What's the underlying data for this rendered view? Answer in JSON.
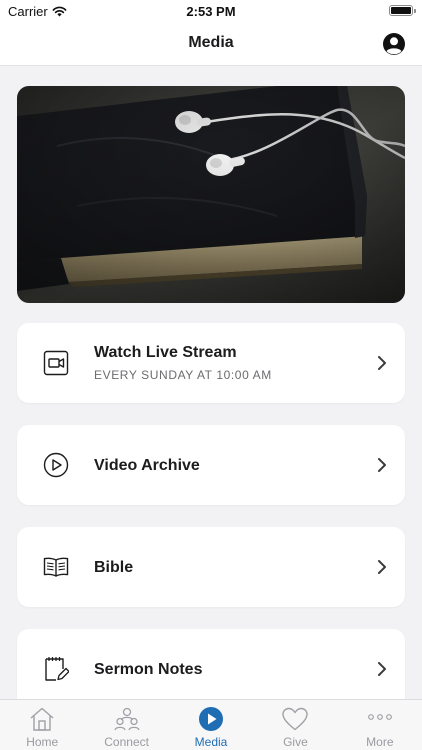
{
  "status_bar": {
    "carrier": "Carrier",
    "time": "2:53 PM"
  },
  "nav": {
    "title": "Media",
    "profile_icon": "person-circle-icon"
  },
  "hero": {
    "image": "earphones-on-bible-photo"
  },
  "menu": [
    {
      "label": "Watch Live Stream",
      "subtitle": "EVERY SUNDAY AT 10:00 AM",
      "icon": "video-camera-icon"
    },
    {
      "label": "Video Archive",
      "subtitle": "",
      "icon": "play-circle-icon"
    },
    {
      "label": "Bible",
      "subtitle": "",
      "icon": "open-book-icon"
    },
    {
      "label": "Sermon Notes",
      "subtitle": "",
      "icon": "notepad-pencil-icon"
    }
  ],
  "tabs": [
    {
      "label": "Home",
      "icon": "house-icon",
      "active": false
    },
    {
      "label": "Connect",
      "icon": "people-icon",
      "active": false
    },
    {
      "label": "Media",
      "icon": "play-circle-filled-icon",
      "active": true
    },
    {
      "label": "Give",
      "icon": "heart-icon",
      "active": false
    },
    {
      "label": "More",
      "icon": "ellipsis-icon",
      "active": false
    }
  ],
  "colors": {
    "accent": "#1f6db3",
    "background": "#f2f2f4",
    "inactive_tab": "#9a9aa0"
  }
}
